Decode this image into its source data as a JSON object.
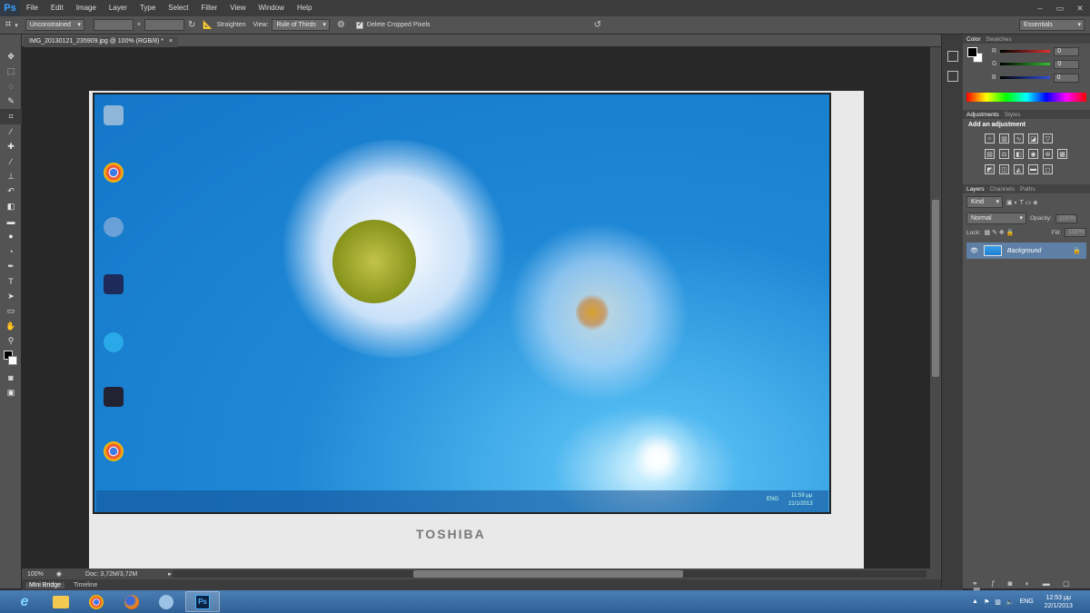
{
  "app": {
    "logo": "Ps",
    "menu": [
      "File",
      "Edit",
      "Image",
      "Layer",
      "Type",
      "Select",
      "Filter",
      "View",
      "Window",
      "Help"
    ],
    "window_controls": [
      "–",
      "▭",
      "✕"
    ]
  },
  "options_bar": {
    "ratio": "Unconstrained",
    "separator": "×",
    "straighten_label": "Straighten",
    "view_label": "View:",
    "view_value": "Rule of Thirds",
    "delete_cropped_label": "Delete Cropped Pixels",
    "workspace": "Essentials"
  },
  "document": {
    "tab_title": "IMG_20130121_235909.jpg @ 100% (RGB/8) *",
    "close": "×",
    "photo_brand": "TOSHIBA",
    "screen_lang": "ENG",
    "screen_time": "11:59 μμ",
    "screen_date": "21/1/2013"
  },
  "status": {
    "zoom": "100%",
    "doc_size": "Doc: 3,72M/3,72M"
  },
  "bottom_tabs": [
    "Mini Bridge",
    "Timeline"
  ],
  "color_panel": {
    "tabs": [
      "Color",
      "Swatches"
    ],
    "channels": [
      {
        "label": "R",
        "value": "0",
        "color": "#e03030"
      },
      {
        "label": "G",
        "value": "0",
        "color": "#30c030"
      },
      {
        "label": "B",
        "value": "0",
        "color": "#3050e0"
      }
    ]
  },
  "adjustments_panel": {
    "tabs": [
      "Adjustments",
      "Styles"
    ],
    "title": "Add an adjustment"
  },
  "layers_panel": {
    "tabs": [
      "Layers",
      "Channels",
      "Paths"
    ],
    "filter": "Kind",
    "blend_mode": "Normal",
    "opacity_label": "Opacity:",
    "opacity_value": "100%",
    "lock_label": "Lock:",
    "fill_label": "Fill:",
    "fill_value": "100%",
    "layer_name": "Background"
  },
  "windows_taskbar": {
    "lang": "ENG",
    "time": "12:53 μμ",
    "date": "22/1/2013"
  }
}
